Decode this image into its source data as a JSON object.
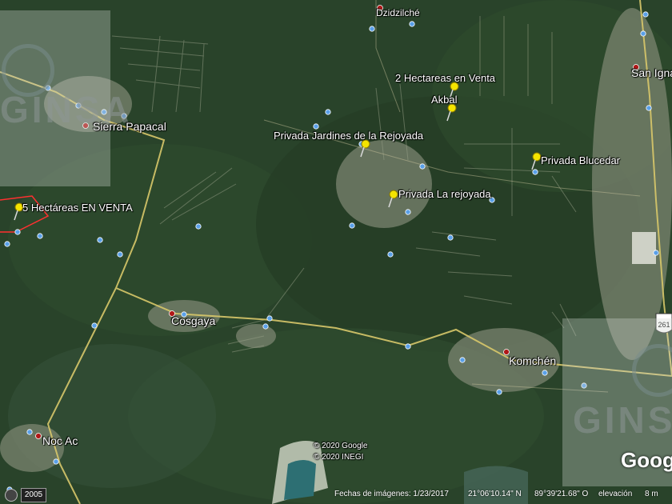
{
  "places": {
    "dzidzilche": "Dzidzilché",
    "san_ignacio": "San Igna",
    "sierra_papacal": "Sierra Papacal",
    "cosgaya": "Cosgaya",
    "komchen": "Komchén",
    "noc_ac": "Noc Ac"
  },
  "placemarks": {
    "hectareas_2": "2 Hectareas en Venta",
    "akbal": "Akbal",
    "jardines": "Privada Jardines de la Rejoyada",
    "blucedar": "Privada Blucedar",
    "rejoyada": "Privada La rejoyada",
    "hectareas_5": "5 Hectáreas EN VENTA"
  },
  "attribution": {
    "google": "© 2020 Google",
    "inegi": "© 2020 INEGI",
    "logo": "Goog"
  },
  "watermark": {
    "text_left": "GINSA",
    "text_right": "GINS"
  },
  "status_bar": {
    "year": "2005",
    "imagery_date": "Fechas de imágenes: 1/23/2017",
    "lat": "21°06'10.14\" N",
    "lon": "89°39'21.68\" O",
    "elevation": "elevación",
    "elevation_value": "8 m"
  },
  "highway_shield": "261",
  "colors": {
    "pin": "#f5e400",
    "road": "#d8c86a",
    "town_dot": "#b01818",
    "poi": "#5aa0e8"
  }
}
